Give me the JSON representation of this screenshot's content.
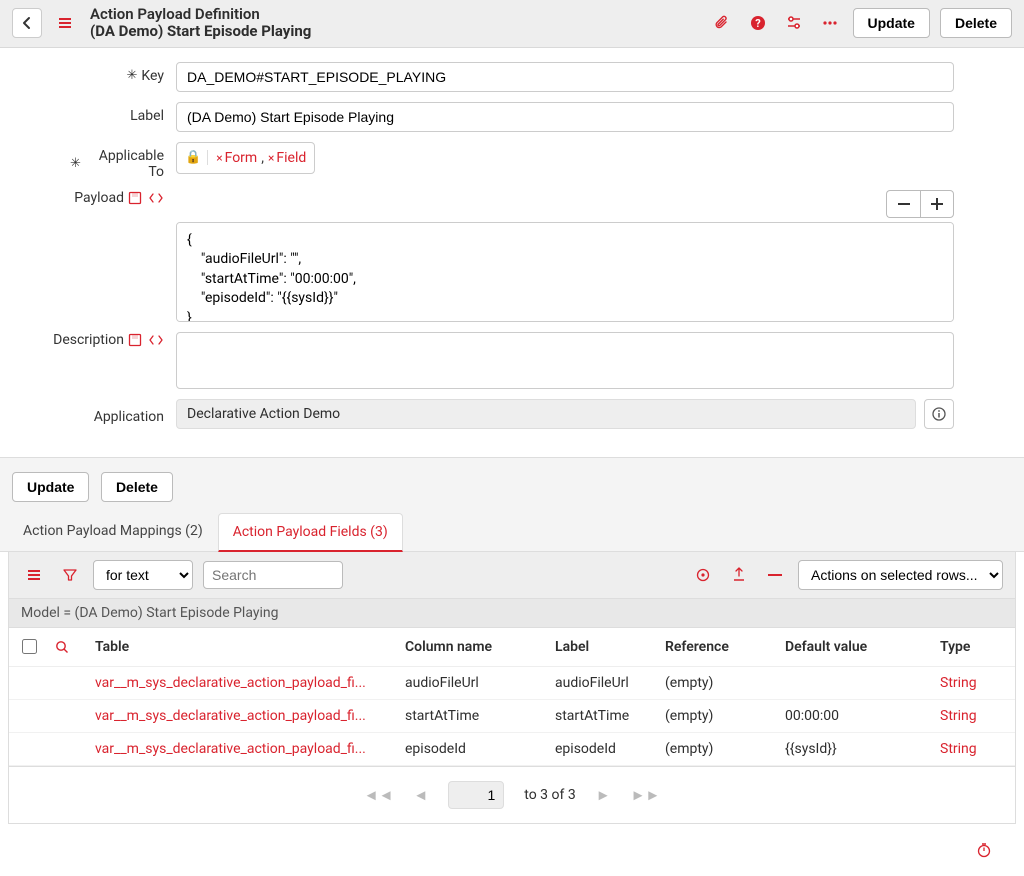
{
  "header": {
    "title_line1": "Action Payload Definition",
    "title_line2": "(DA Demo) Start Episode Playing",
    "update_label": "Update",
    "delete_label": "Delete"
  },
  "form": {
    "key_label": "Key",
    "key_value": "DA_DEMO#START_EPISODE_PLAYING",
    "label_label": "Label",
    "label_value": "(DA Demo) Start Episode Playing",
    "applicable_to_label": "Applicable To",
    "applicable_to_tags": [
      "Form",
      "Field"
    ],
    "payload_label": "Payload",
    "payload_value": "{\n    \"audioFileUrl\": \"\",\n    \"startAtTime\": \"00:00:00\",\n    \"episodeId\": \"{{sysId}}\"\n}",
    "description_label": "Description",
    "description_value": "",
    "application_label": "Application",
    "application_value": "Declarative Action Demo"
  },
  "lower": {
    "update_label": "Update",
    "delete_label": "Delete"
  },
  "tabs": [
    {
      "label": "Action Payload Mappings (2)",
      "active": false
    },
    {
      "label": "Action Payload Fields (3)",
      "active": true
    }
  ],
  "table_toolbar": {
    "filter_mode": "for text",
    "search_placeholder": "Search",
    "actions_placeholder": "Actions on selected rows..."
  },
  "model_row": "Model = (DA Demo) Start Episode Playing",
  "columns": {
    "table": "Table",
    "column_name": "Column name",
    "label": "Label",
    "reference": "Reference",
    "default_value": "Default value",
    "type": "Type"
  },
  "rows": [
    {
      "table": "var__m_sys_declarative_action_payload_fi...",
      "column_name": "audioFileUrl",
      "label": "audioFileUrl",
      "reference": "(empty)",
      "default_value": "",
      "type": "String"
    },
    {
      "table": "var__m_sys_declarative_action_payload_fi...",
      "column_name": "startAtTime",
      "label": "startAtTime",
      "reference": "(empty)",
      "default_value": "00:00:00",
      "type": "String"
    },
    {
      "table": "var__m_sys_declarative_action_payload_fi...",
      "column_name": "episodeId",
      "label": "episodeId",
      "reference": "(empty)",
      "default_value": "{{sysId}}",
      "type": "String"
    }
  ],
  "pager": {
    "page_value": "1",
    "range_text": "to 3 of 3"
  }
}
